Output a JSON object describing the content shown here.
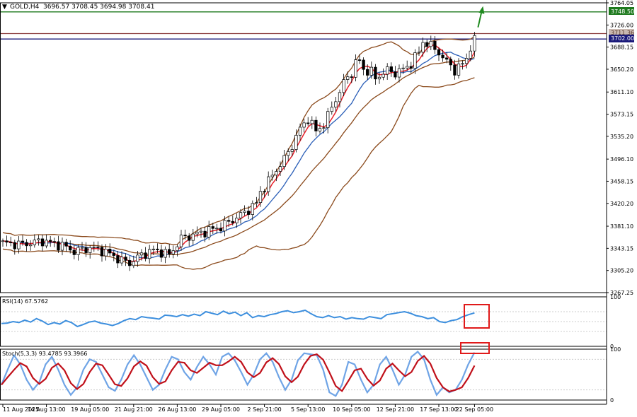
{
  "header": {
    "symbol": "GOLD,H4",
    "ohlc": "3696.57 3708.45 3694.98 3708.41"
  },
  "colors": {
    "background": "#ffffff",
    "candle": "#000000",
    "ema_fast": "#e8202a",
    "ema_slow": "#2b5fb8",
    "ema_mid": "#8fb4e6",
    "bollinger": "#8b4a1c",
    "resistance_line": "#1e7a1e",
    "support_line": "#1a1a7a",
    "rsi": "#3d8fde",
    "stoch_main": "#c0101a",
    "stoch_signal": "#6fa4e6",
    "highlight_box": "#e01a1a",
    "arrow": "#1f8a1f"
  },
  "price_labels": {
    "resistance": "3748.50",
    "level_a": "3711.36",
    "level_b": "3702.00"
  },
  "rsi_panel": {
    "title": "RSI(14) 67.5762"
  },
  "stoch_panel": {
    "title": "Stoch(5,3,3) 93.4785 93.3966"
  },
  "chart_data": [
    {
      "type": "candlestick",
      "x_tick_labels": [
        "11 Aug 2025",
        "14 Aug 13:00",
        "19 Aug 05:00",
        "21 Aug 21:00",
        "26 Aug 13:00",
        "29 Aug 05:00",
        "2 Sep 21:00",
        "5 Sep 13:00",
        "10 Sep 05:00",
        "12 Sep 21:00",
        "17 Sep 13:00",
        "22 Sep 05:00"
      ],
      "y_tick_labels": [
        "3764.05",
        "3726.00",
        "3688.15",
        "3650.20",
        "3611.10",
        "3573.15",
        "3535.20",
        "3496.10",
        "3458.15",
        "3420.20",
        "3381.10",
        "3343.15",
        "3305.20",
        "3267.25"
      ],
      "ylim": [
        3267.25,
        3764.05
      ],
      "horizontal_levels": [
        3748.5,
        3711.36,
        3702.0
      ],
      "close_path": [
        [
          0,
          3352
        ],
        [
          5,
          3350
        ],
        [
          10,
          3356
        ],
        [
          15,
          3348
        ],
        [
          18,
          3338
        ],
        [
          22,
          3344
        ],
        [
          25,
          3340
        ],
        [
          28,
          3330
        ],
        [
          30,
          3322
        ],
        [
          32,
          3318
        ],
        [
          35,
          3332
        ],
        [
          38,
          3340
        ],
        [
          40,
          3337
        ],
        [
          42,
          3332
        ],
        [
          45,
          3360
        ],
        [
          48,
          3366
        ],
        [
          50,
          3370
        ],
        [
          52,
          3374
        ],
        [
          55,
          3380
        ],
        [
          58,
          3392
        ],
        [
          60,
          3400
        ],
        [
          62,
          3410
        ],
        [
          64,
          3420
        ],
        [
          65,
          3440
        ],
        [
          67,
          3458
        ],
        [
          69,
          3478
        ],
        [
          71,
          3496
        ],
        [
          73,
          3520
        ],
        [
          75,
          3548
        ],
        [
          77,
          3566
        ],
        [
          79,
          3544
        ],
        [
          81,
          3556
        ],
        [
          82,
          3570
        ],
        [
          84,
          3600
        ],
        [
          85,
          3610
        ],
        [
          86,
          3628
        ],
        [
          88,
          3645
        ],
        [
          89,
          3660
        ],
        [
          90,
          3665
        ],
        [
          91,
          3650
        ],
        [
          93,
          3645
        ],
        [
          94,
          3634
        ],
        [
          95,
          3640
        ],
        [
          97,
          3648
        ],
        [
          99,
          3644
        ],
        [
          101,
          3650
        ],
        [
          103,
          3660
        ],
        [
          105,
          3680
        ],
        [
          106,
          3698
        ],
        [
          108,
          3690
        ],
        [
          110,
          3680
        ],
        [
          111,
          3668
        ],
        [
          113,
          3658
        ],
        [
          114,
          3648
        ],
        [
          115,
          3652
        ],
        [
          116,
          3660
        ],
        [
          117,
          3670
        ],
        [
          118,
          3688
        ],
        [
          119,
          3700
        ],
        [
          120,
          3708
        ]
      ]
    },
    {
      "type": "line",
      "name": "RSI(14)",
      "ylim": [
        0,
        100
      ],
      "y_ticks": [
        0,
        100
      ],
      "last_value": 67.5762,
      "values": [
        46,
        47,
        50,
        48,
        53,
        49,
        56,
        51,
        44,
        48,
        45,
        52,
        48,
        40,
        44,
        49,
        51,
        47,
        45,
        42,
        46,
        52,
        56,
        54,
        60,
        58,
        57,
        55,
        63,
        62,
        60,
        64,
        61,
        65,
        62,
        70,
        67,
        64,
        71,
        66,
        69,
        62,
        68,
        58,
        62,
        60,
        64,
        66,
        70,
        72,
        68,
        70,
        73,
        66,
        60,
        58,
        62,
        58,
        60,
        55,
        58,
        56,
        55,
        60,
        58,
        56,
        64,
        66,
        68,
        70,
        67,
        62,
        60,
        56,
        58,
        50,
        48,
        52,
        54,
        60,
        64,
        67.6
      ]
    },
    {
      "type": "line",
      "name": "Stoch(5,3,3)",
      "ylim": [
        0,
        100
      ],
      "y_ticks": [
        0,
        100
      ],
      "last_main": 93.4785,
      "last_signal": 93.3966,
      "main": [
        30,
        60,
        88,
        70,
        40,
        20,
        35,
        70,
        85,
        60,
        30,
        10,
        25,
        60,
        80,
        75,
        50,
        25,
        18,
        40,
        70,
        88,
        70,
        45,
        20,
        30,
        60,
        85,
        80,
        55,
        40,
        65,
        85,
        70,
        50,
        85,
        92,
        78,
        55,
        30,
        50,
        80,
        92,
        75,
        45,
        20,
        40,
        78,
        92,
        90,
        88,
        60,
        15,
        8,
        30,
        75,
        70,
        40,
        15,
        30,
        70,
        85,
        60,
        30,
        50,
        85,
        95,
        80,
        40,
        10,
        25,
        15,
        20,
        40,
        70,
        93.5
      ]
    }
  ]
}
